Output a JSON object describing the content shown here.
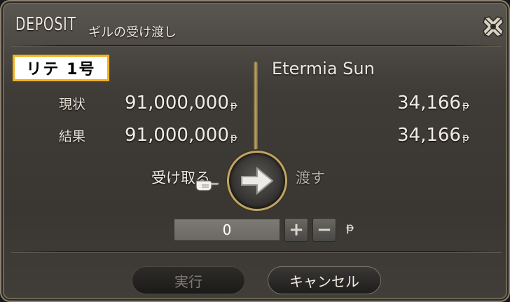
{
  "window": {
    "title_en": "DEPOSIT",
    "title_jp": "ギルの受け渡し",
    "close_icon": "close-icon"
  },
  "self": {
    "name": "リテ 1号",
    "current_label": "現状",
    "result_label": "結果",
    "current_gil": "91,000,000",
    "result_gil": "91,000,000"
  },
  "partner": {
    "name": "Etermia Sun",
    "current_gil": "34,166",
    "result_gil": "34,166"
  },
  "currency_symbol": "ᵽ",
  "transfer": {
    "receive_label": "受け取る",
    "give_label": "渡す",
    "direction": "receive",
    "amount": "0",
    "plus_label": "+",
    "minus_label": "−"
  },
  "footer": {
    "execute_label": "実行",
    "cancel_label": "キャンセル"
  },
  "colors": {
    "accent_gold": "#c1a462",
    "badge_border": "#f2b21c",
    "text": "#efe9dd"
  }
}
